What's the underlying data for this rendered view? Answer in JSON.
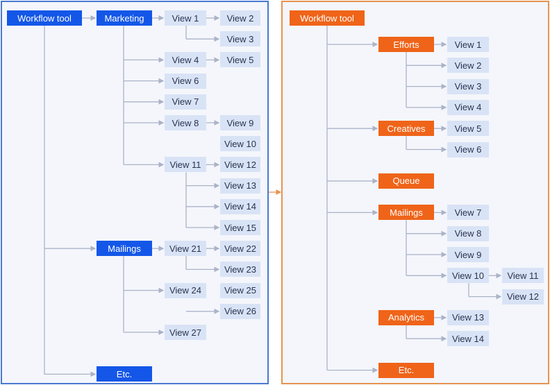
{
  "colors": {
    "blue_accent": "#1457e8",
    "orange_accent": "#ef6419",
    "view_fill": "#d9e3f6",
    "view_text": "#2a3350",
    "connector": "#aab3c8",
    "left_border": "#4a78d0",
    "right_border": "#e8924f"
  },
  "left": {
    "root": "Workflow tool",
    "sections": [
      {
        "label": "Marketing",
        "children": [
          {
            "label": "View 1",
            "children": [
              "View 2",
              "View 3"
            ]
          },
          {
            "label": "View 4",
            "children": [
              "View 5"
            ]
          },
          {
            "label": "View 6",
            "children": []
          },
          {
            "label": "View 7",
            "children": []
          },
          {
            "label": "View 8",
            "children": [
              "View 9"
            ]
          },
          {
            "label": "View 11",
            "children": [
              "View 12",
              "View 13",
              "View 14",
              "View 15"
            ]
          }
        ],
        "orphans": [
          "View 10"
        ]
      },
      {
        "label": "Mailings",
        "children": [
          {
            "label": "View 21",
            "children": [
              "View 22",
              "View 23"
            ]
          },
          {
            "label": "View 24",
            "children": [
              "View 26"
            ]
          },
          {
            "label": "View 27",
            "children": []
          }
        ],
        "orphans": [
          "View 25"
        ]
      },
      {
        "label": "Etc.",
        "children": [],
        "orphans": []
      }
    ]
  },
  "right": {
    "root": "Workflow tool",
    "sections": [
      {
        "label": "Efforts",
        "connected": true,
        "children": [
          {
            "label": "View 1",
            "children": []
          },
          {
            "label": "View 2",
            "children": []
          },
          {
            "label": "View 3",
            "children": []
          },
          {
            "label": "View 4",
            "children": []
          }
        ]
      },
      {
        "label": "Creatives",
        "connected": true,
        "children": [
          {
            "label": "View 5",
            "children": []
          },
          {
            "label": "View 6",
            "children": []
          }
        ]
      },
      {
        "label": "Queue",
        "connected": true,
        "children": []
      },
      {
        "label": "Mailings",
        "connected": true,
        "children": [
          {
            "label": "View 7",
            "children": []
          },
          {
            "label": "View 8",
            "children": []
          },
          {
            "label": "View 9",
            "children": []
          },
          {
            "label": "View 10",
            "children": [
              "View 11",
              "View 12"
            ]
          }
        ]
      },
      {
        "label": "Analytics",
        "connected": false,
        "children": [
          {
            "label": "View 13",
            "children": []
          },
          {
            "label": "View 14",
            "children": []
          }
        ]
      },
      {
        "label": "Etc.",
        "connected": true,
        "children": []
      }
    ]
  }
}
